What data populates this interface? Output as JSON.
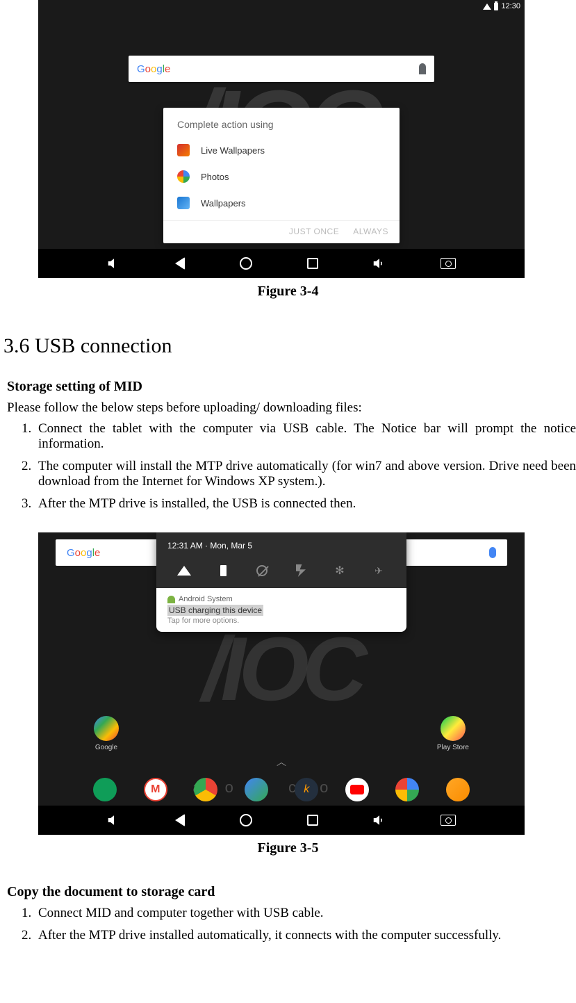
{
  "figure34": {
    "status_bar": {
      "time": "12:30"
    },
    "search_bar": {
      "logo": "Google"
    },
    "dialog": {
      "title": "Complete action using",
      "options": [
        {
          "label": "Live Wallpapers"
        },
        {
          "label": "Photos"
        },
        {
          "label": "Wallpapers"
        }
      ],
      "buttons": {
        "just_once": "JUST ONCE",
        "always": "ALWAYS"
      }
    },
    "caption": "Figure 3-4"
  },
  "section": {
    "heading": "3.6 USB connection",
    "sub1_title": "Storage setting of MID",
    "sub1_intro": "Please follow the below steps before uploading/ downloading files:",
    "sub1_steps": [
      "Connect the tablet with the computer via USB cable. The Notice bar will prompt the notice information.",
      "The computer will install the MTP drive automatically (for win7 and above version. Drive need been download from the Internet for Windows XP system.).",
      "After the MTP drive is installed, the USB is connected then."
    ],
    "sub2_title": "Copy the document to storage card",
    "sub2_steps": [
      "Connect MID and computer together with USB cable.",
      "After the MTP drive installed automatically, it connects with the computer successfully."
    ]
  },
  "figure35": {
    "search_bar": {
      "logo": "Google"
    },
    "notification": {
      "datetime": "12:31 AM · Mon, Mar 5",
      "app_name": "Android System",
      "title": "USB charging this device",
      "subtitle": "Tap for more options."
    },
    "apps_mid": [
      {
        "label": "Google"
      },
      {
        "label": "Play Store"
      }
    ],
    "bg_text": "a o c  c o n",
    "caption": "Figure 3-5"
  }
}
